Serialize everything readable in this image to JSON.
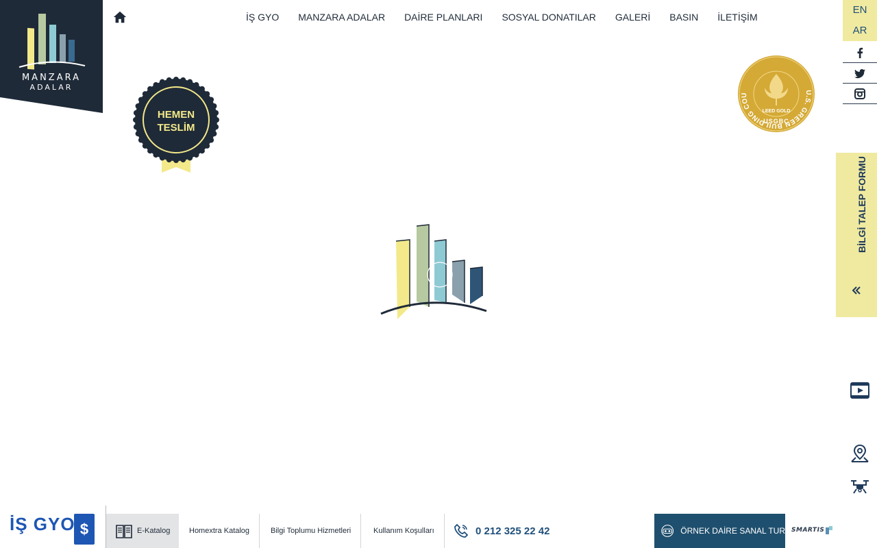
{
  "logo": {
    "line1": "MANZARA",
    "line2": "ADALAR"
  },
  "nav": {
    "items": [
      "İŞ GYO",
      "MANZARA ADALAR",
      "DAİRE PLANLARI",
      "SOSYAL DONATILAR",
      "GALERİ",
      "BASIN",
      "İLETİŞİM"
    ]
  },
  "lang": {
    "en": "EN",
    "ar": "AR"
  },
  "badges": {
    "hemen_line1": "HEMEN",
    "hemen_line2": "TESLİM",
    "leed_gold": "LEED GOLD",
    "usgbc": "USGBC",
    "leed_ring": "U.S. GREEN BUILDING COUNCIL"
  },
  "side": {
    "form_label": "BİLGİ TALEP FORMU"
  },
  "footer": {
    "brand": "İŞ GYO",
    "ekatalog": "E-Katalog",
    "homextra": "Homextra Katalog",
    "bilgi": "Bilgi Toplumu Hizmetleri",
    "kullanim": "Kullanım Koşulları",
    "phone": "0 212 325 22 42",
    "tour": "ÖRNEK DAİRE SANAL TUR",
    "smartis": "SMARTIS"
  },
  "icons": {
    "home": "home-icon",
    "facebook": "facebook-icon",
    "twitter": "twitter-icon",
    "instagram": "instagram-icon",
    "video": "video-icon",
    "map": "map-pin-icon",
    "drone": "drone-icon",
    "phone": "phone-icon",
    "book": "book-icon",
    "vr": "vr-headset-icon"
  },
  "colors": {
    "navy": "#1f2a38",
    "yellow": "#f0eaa0",
    "blue": "#1e56b3",
    "teal": "#1f4f6e",
    "gold": "#d4a935"
  }
}
